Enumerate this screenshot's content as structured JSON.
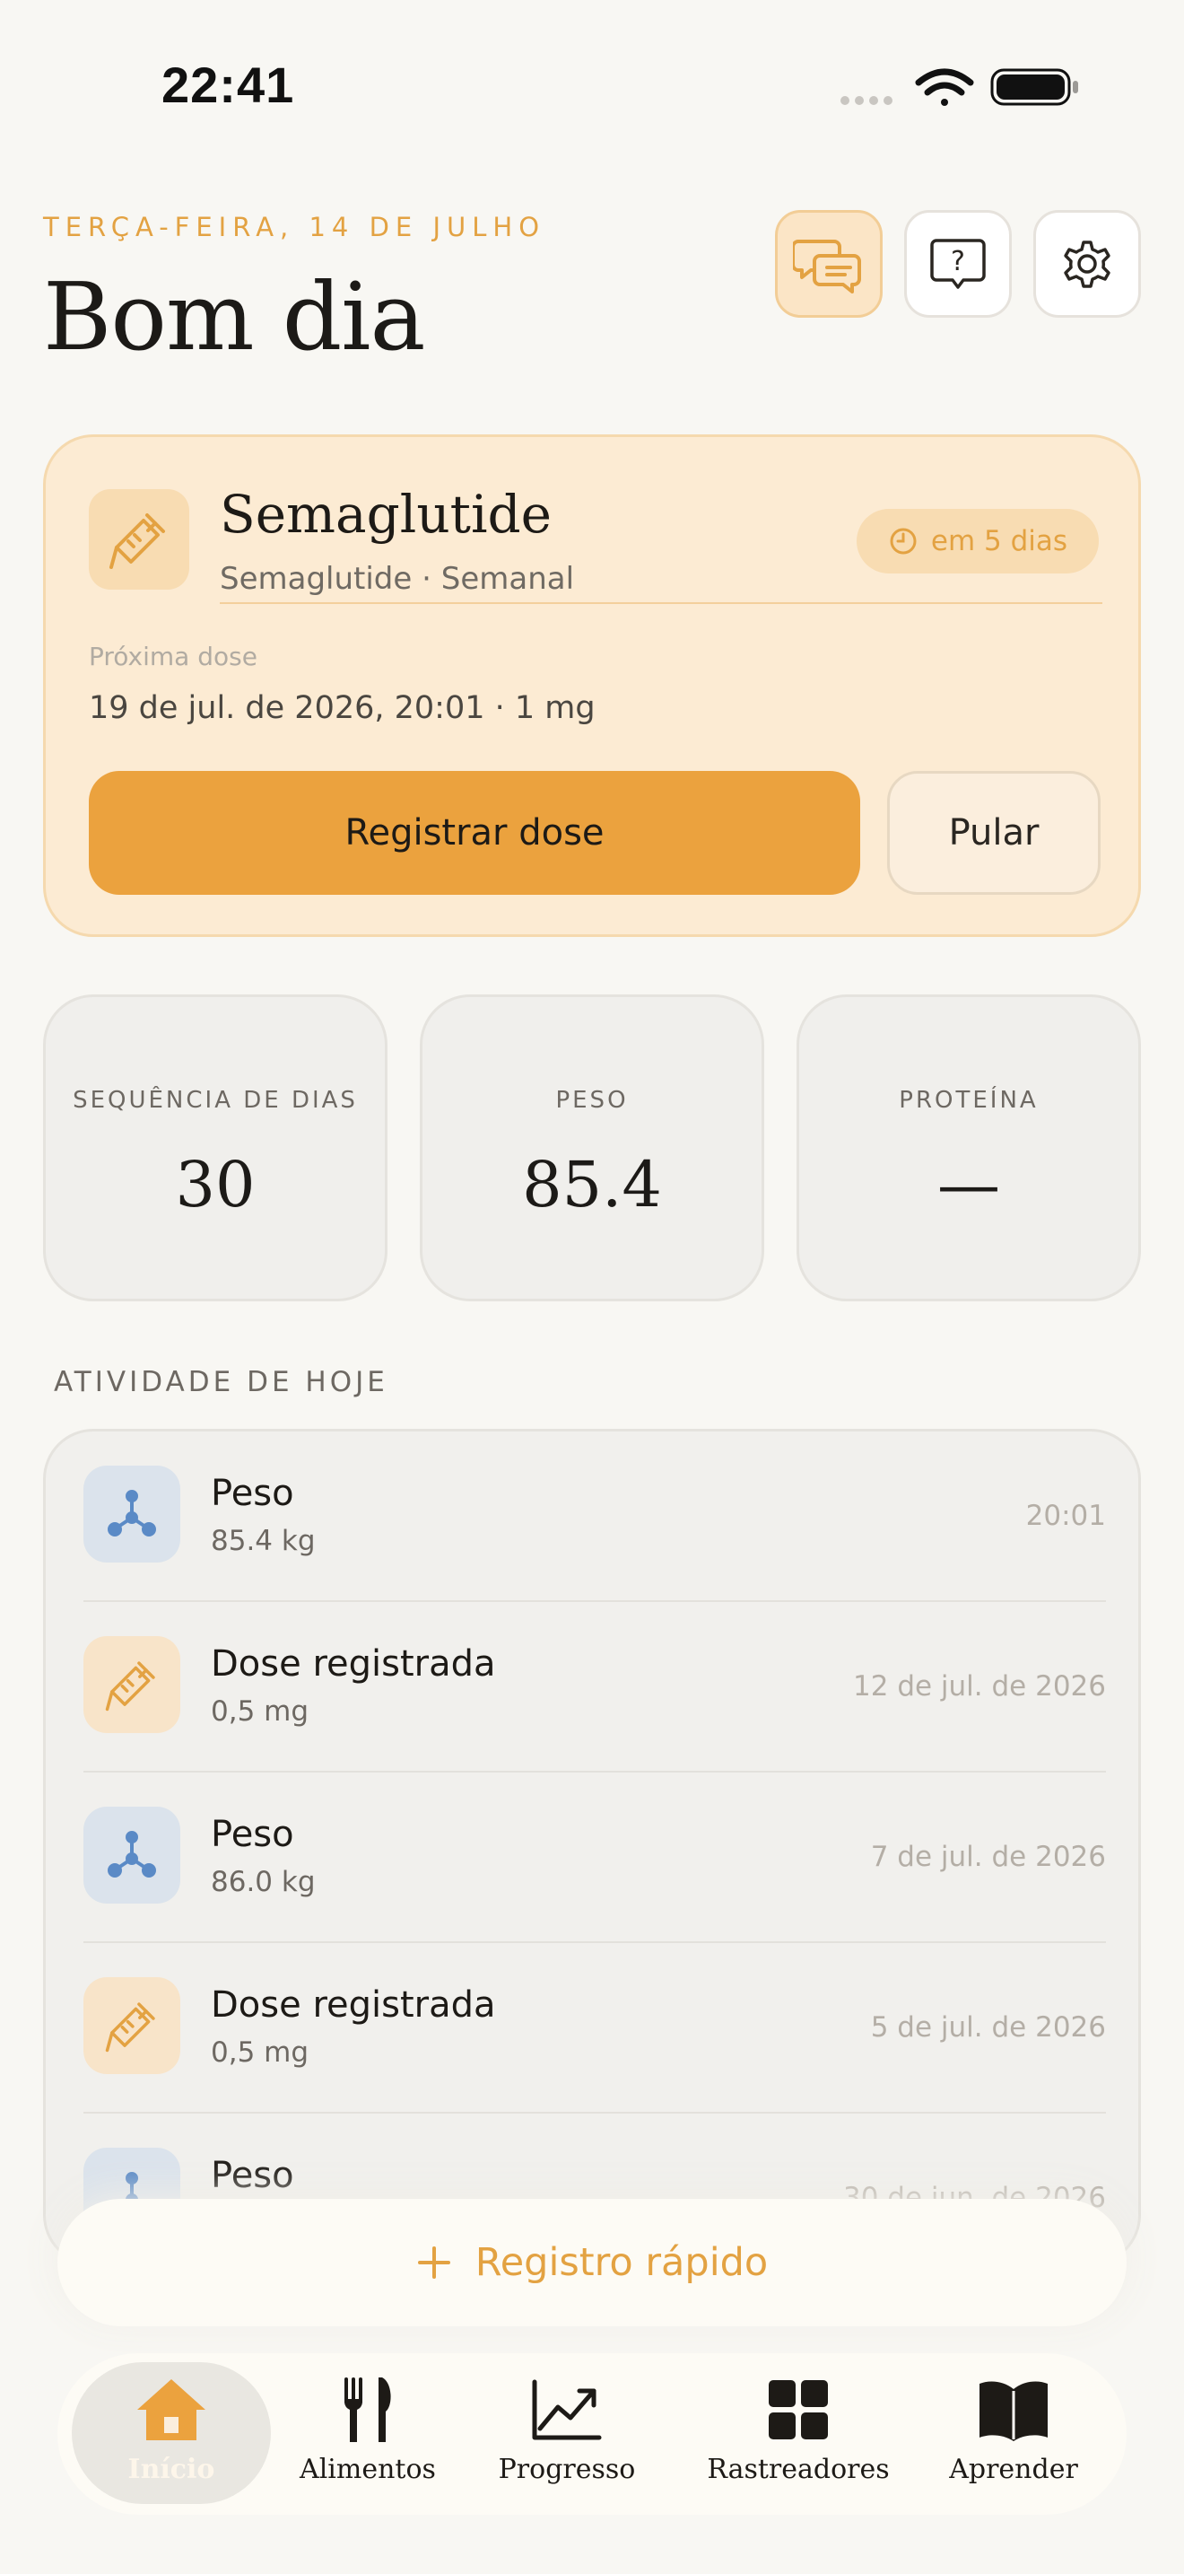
{
  "status_bar": {
    "time": "22:41"
  },
  "header": {
    "date": "TERÇA-FEIRA, 14 DE JULHO",
    "greeting": "Bom dia",
    "buttons": [
      {
        "icon": "chat-bubbles-icon"
      },
      {
        "icon": "help-icon"
      },
      {
        "icon": "gear-icon"
      }
    ]
  },
  "medication": {
    "icon": "syringe-icon",
    "name": "Semaglutide",
    "subtitle": "Semaglutide · Semanal",
    "badge": "em 5 dias",
    "next_dose_label": "Próxima dose",
    "next_dose_value": "19 de jul. de 2026, 20:01 · 1 mg",
    "log_button": "Registrar dose",
    "skip_button": "Pular"
  },
  "stats": [
    {
      "label": "SEQUÊNCIA DE DIAS",
      "value": "30"
    },
    {
      "label": "PESO",
      "value": "85.4"
    },
    {
      "label": "PROTEÍNA",
      "value": "—"
    }
  ],
  "activity": {
    "title": "ATIVIDADE DE HOJE",
    "items": [
      {
        "icon": "weight-icon",
        "title": "Peso",
        "sub": "85.4 kg",
        "time": "20:01"
      },
      {
        "icon": "syringe-icon",
        "title": "Dose registrada",
        "sub": "0,5 mg",
        "time": "12 de jul. de 2026"
      },
      {
        "icon": "weight-icon",
        "title": "Peso",
        "sub": "86.0 kg",
        "time": "7 de jul. de 2026"
      },
      {
        "icon": "syringe-icon",
        "title": "Dose registrada",
        "sub": "0,5 mg",
        "time": "5 de jul. de 2026"
      },
      {
        "icon": "weight-icon",
        "title": "Peso",
        "sub": "",
        "time": "30 de jun. de 2026"
      }
    ]
  },
  "quick_log": {
    "label": "Registro rápido"
  },
  "tabs": [
    {
      "label": "Início",
      "icon": "home-icon",
      "active": true
    },
    {
      "label": "Alimentos",
      "icon": "fork-knife-icon"
    },
    {
      "label": "Progresso",
      "icon": "chart-icon"
    },
    {
      "label": "Rastreadores",
      "icon": "grid-icon"
    },
    {
      "label": "Aprender",
      "icon": "book-icon"
    }
  ],
  "colors": {
    "accent": "#eba23e",
    "accent_text": "#e3a242",
    "background": "#f8f7f3",
    "weight_icon": "#5a8ac6"
  }
}
